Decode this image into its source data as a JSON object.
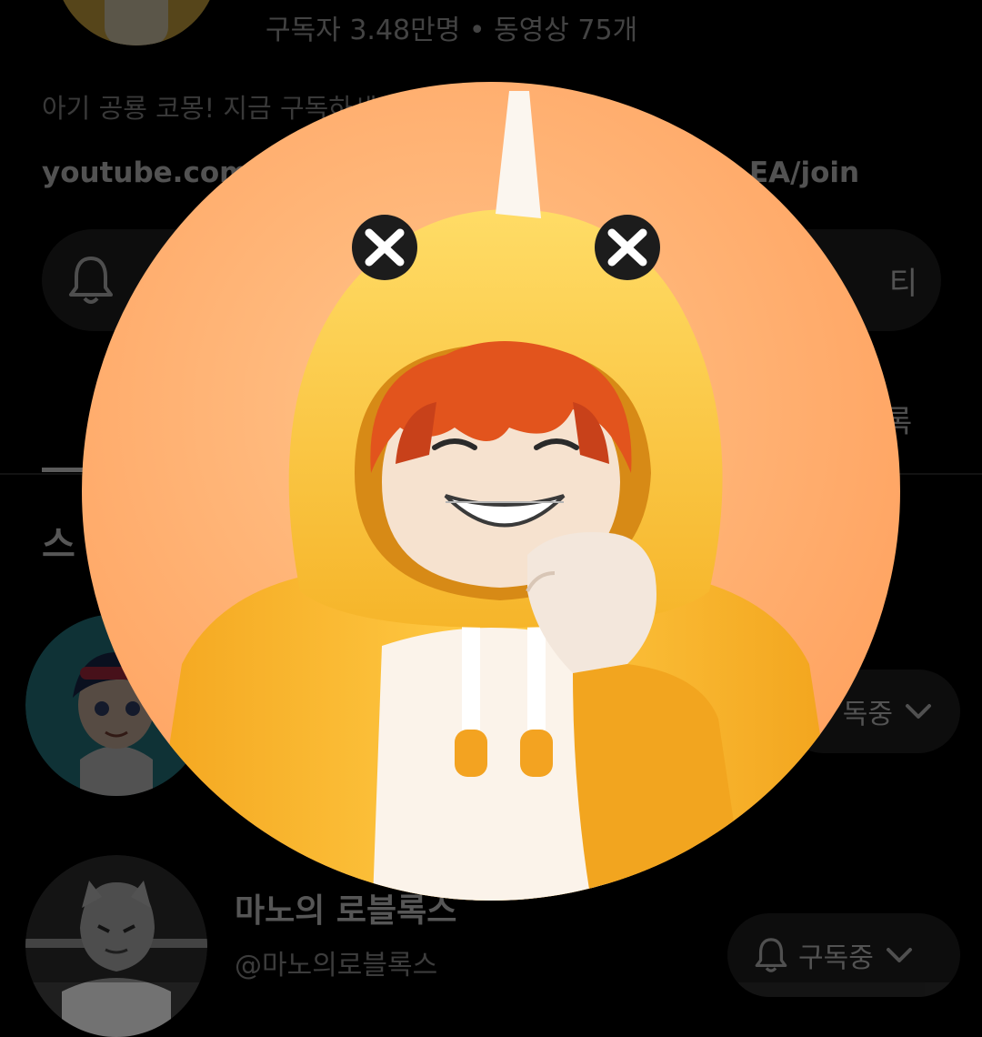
{
  "channel": {
    "stats": "구독자 3.48만명 • 동영상 75개",
    "description": "아기 공룡 코몽! 지금 구독하세",
    "link_start": "youtube.com/",
    "link_end": "EA/join",
    "community_label": "티",
    "playlist_label": "록",
    "section_title": "스"
  },
  "subscriptions": [
    {
      "name": "",
      "handle": "",
      "button_label": "독중"
    },
    {
      "name": "마노의 로블록스",
      "handle": "@마노의로블록스",
      "button_label": "구독중"
    }
  ],
  "viewer": {
    "subject": "yellow dinosaur hoodie avatar"
  },
  "colors": {
    "background": "#000000",
    "pill": "#262626",
    "viewer_bg": "#FFB070",
    "hoodie": "#F9B62C",
    "hoodie_light": "#FFD24A"
  }
}
